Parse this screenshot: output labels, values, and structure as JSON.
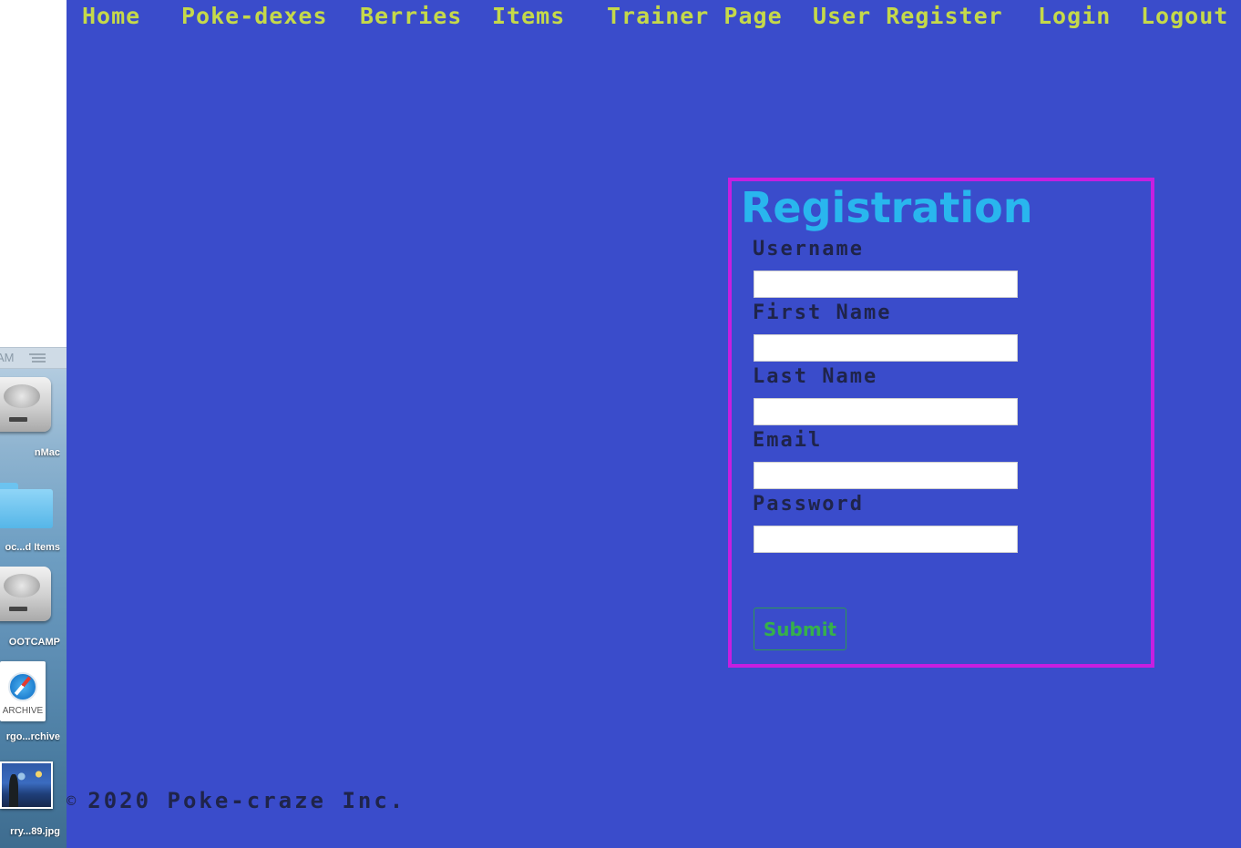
{
  "desktop": {
    "clock_fragment": "AM",
    "items": [
      {
        "label": "nMac",
        "icon": "hard-drive-icon"
      },
      {
        "label": "oc...d Items",
        "icon": "folder-icon"
      },
      {
        "label": "OOTCAMP",
        "icon": "hard-drive-icon"
      },
      {
        "label": "rgo...rchive",
        "icon": "archive-icon",
        "icon_text": "ARCHIVE"
      },
      {
        "label": "rry...89.jpg",
        "icon": "image-thumbnail-icon"
      }
    ]
  },
  "nav": {
    "items": [
      {
        "label": "Home"
      },
      {
        "label": "Poke-dexes"
      },
      {
        "label": "Berries"
      },
      {
        "label": "Items"
      },
      {
        "label": "Trainer Page"
      },
      {
        "label": "User Register"
      },
      {
        "label": "Login"
      },
      {
        "label": "Logout"
      }
    ]
  },
  "form": {
    "title": "Registration",
    "fields": [
      {
        "label": "Username",
        "value": ""
      },
      {
        "label": "First Name",
        "value": ""
      },
      {
        "label": "Last Name",
        "value": ""
      },
      {
        "label": "Email",
        "value": ""
      },
      {
        "label": "Password",
        "value": ""
      }
    ],
    "submit_label": "Submit"
  },
  "footer": {
    "copyright_symbol": "©",
    "text": "2020 Poke-craze Inc."
  },
  "colors": {
    "page_background": "#3a4ccb",
    "nav_text": "#c5d94a",
    "form_border": "#c61fe0",
    "title_text": "#29b6ee",
    "label_text": "#1f244a",
    "submit_text": "#36b04c"
  }
}
